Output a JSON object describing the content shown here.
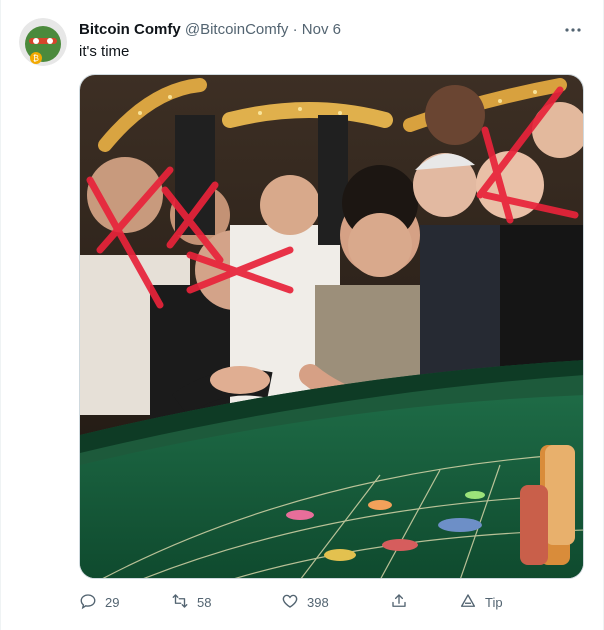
{
  "tweet": {
    "display_name": "Bitcoin Comfy",
    "handle": "@BitcoinComfy",
    "separator": "·",
    "date": "Nov 6",
    "text": "it's time"
  },
  "actions": {
    "replies": "29",
    "retweets": "58",
    "likes": "398",
    "tip_label": "Tip"
  },
  "icons": {
    "more": "more-horizontal-icon",
    "reply": "reply-icon",
    "retweet": "retweet-icon",
    "like": "heart-icon",
    "share": "share-icon",
    "tip": "tip-icon"
  },
  "colors": {
    "text": "#0f1419",
    "secondary": "#536471",
    "border": "#cfd9de",
    "table_felt": "#1f7a4a",
    "cross_marks": "#e8233a"
  }
}
